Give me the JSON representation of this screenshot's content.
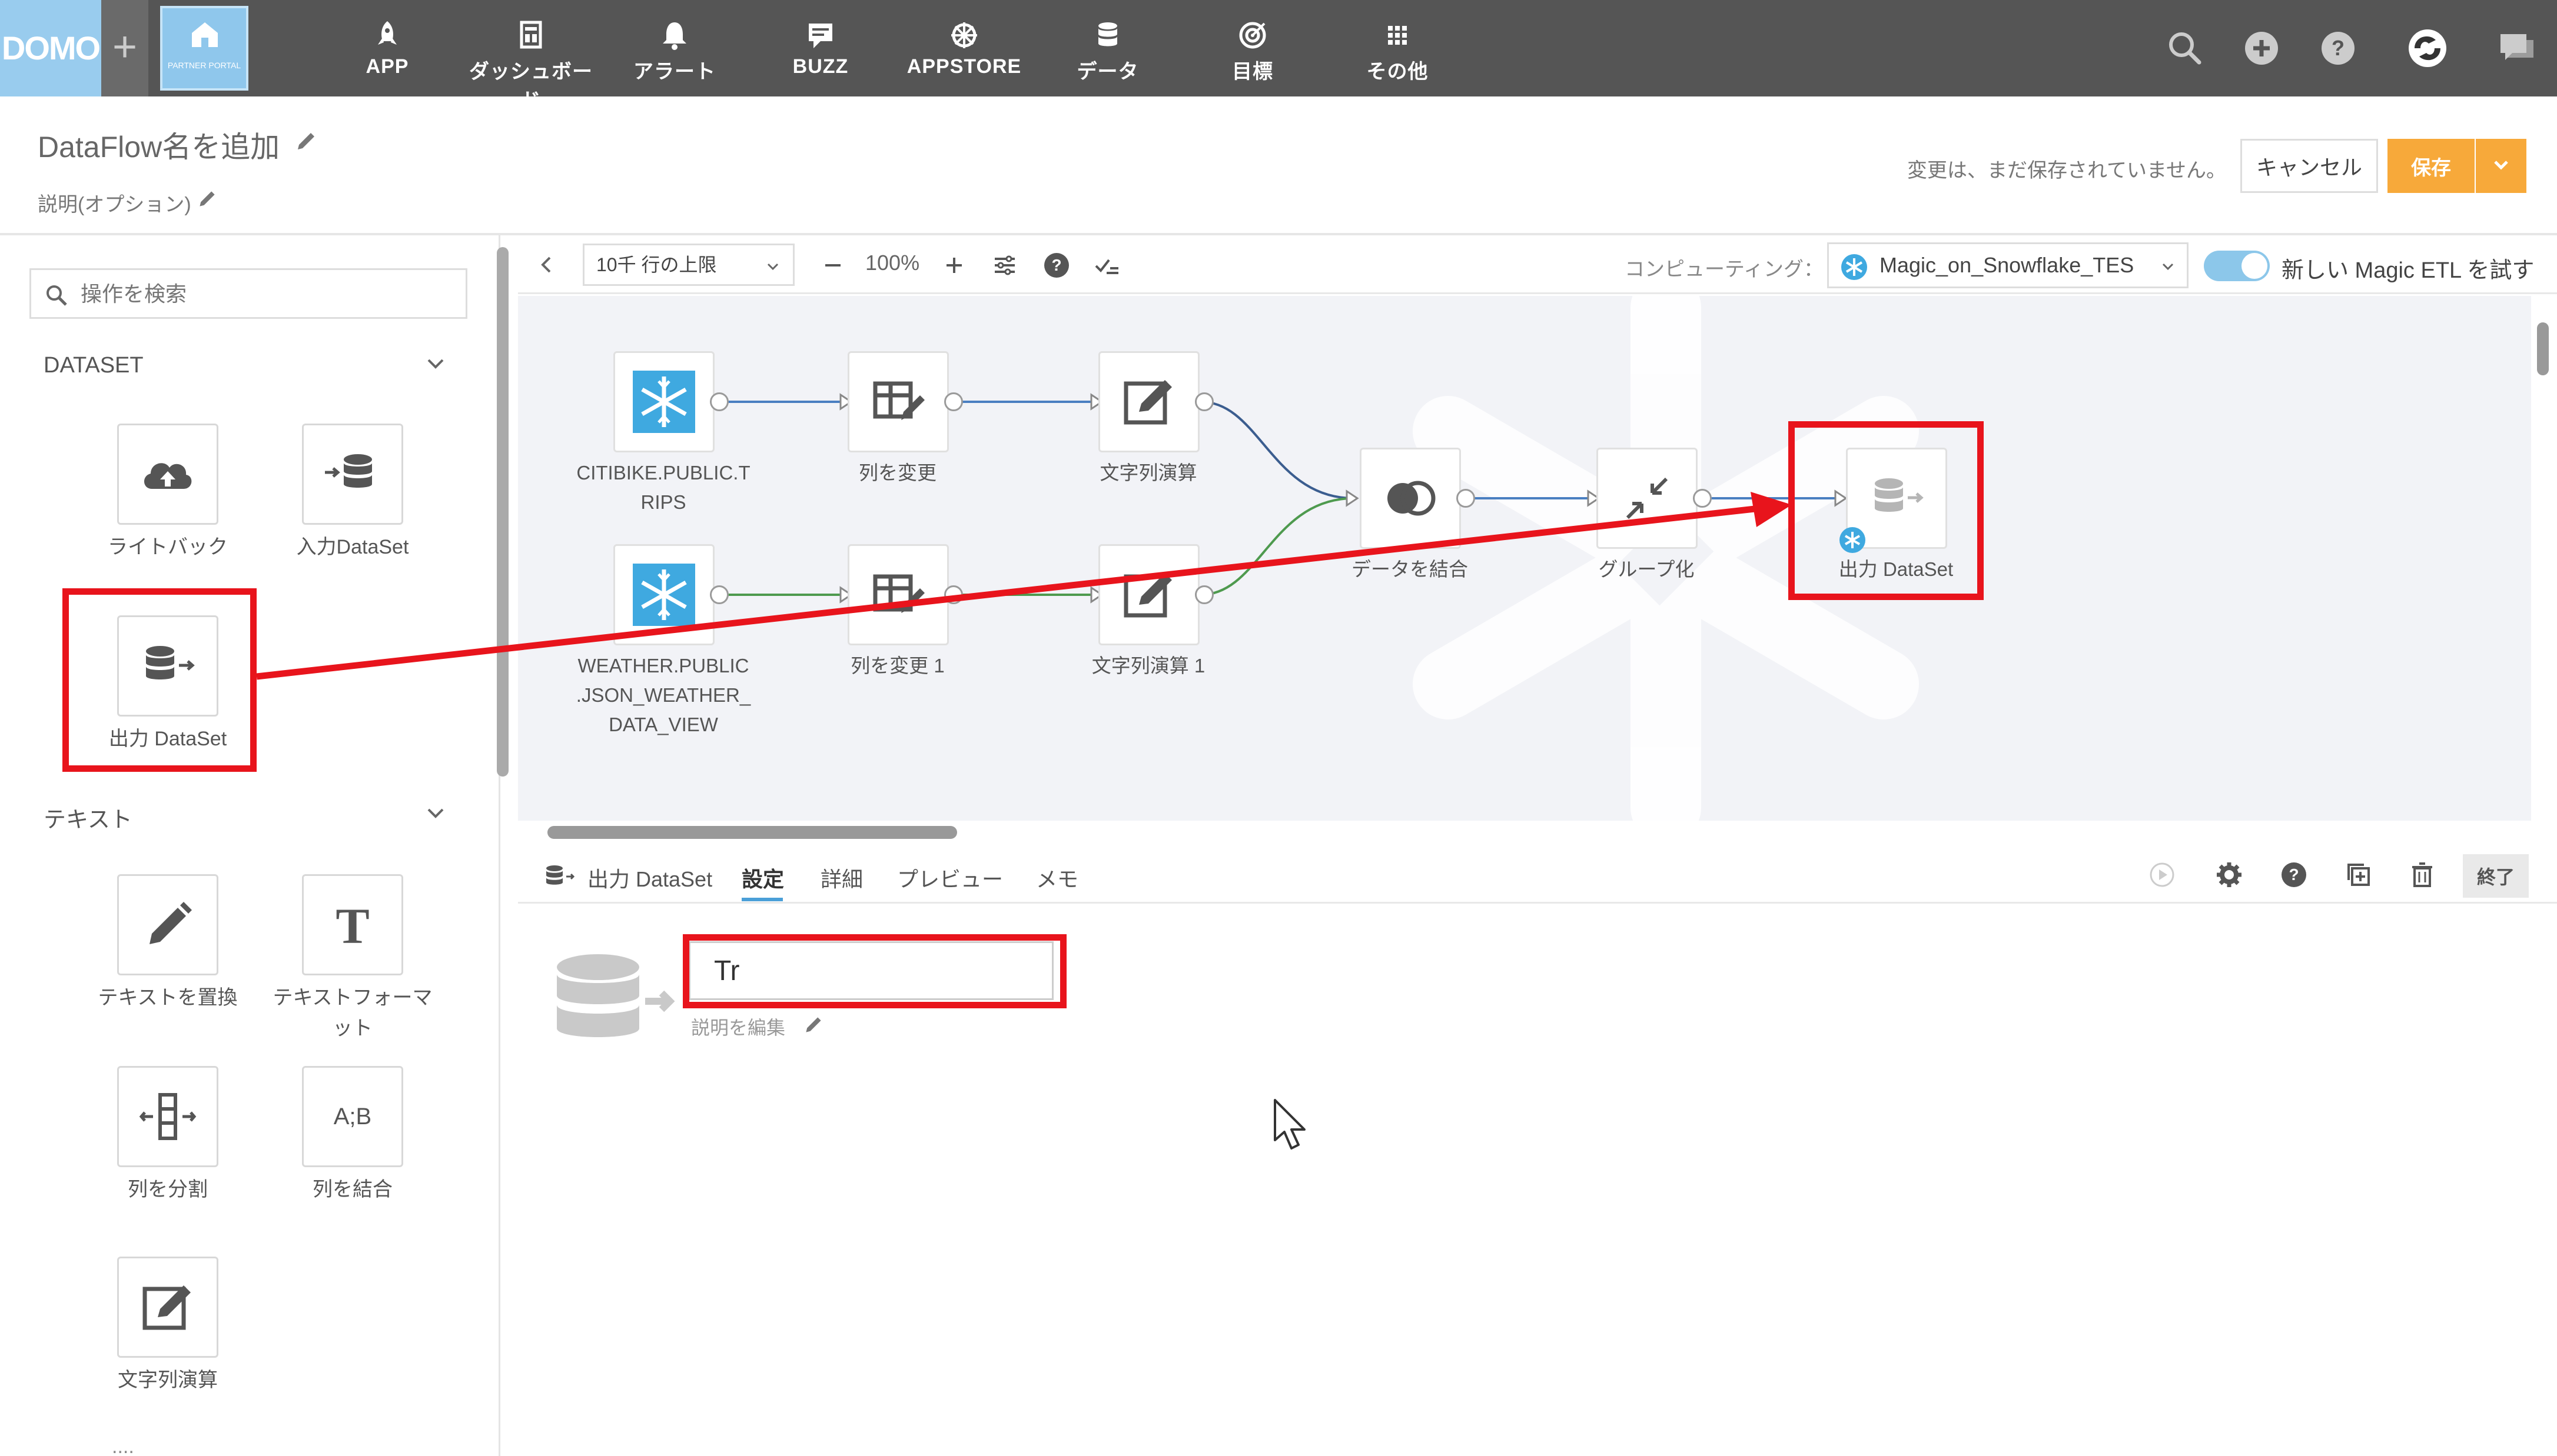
{
  "colors": {
    "nav_bg": "#555555",
    "accent_blue": "#4a9fd8",
    "save_orange": "#f7a93a",
    "annotation_red": "#e8141c"
  },
  "nav": {
    "logo": "DOMO",
    "plus": "+",
    "portal_text": "PARTNER PORTAL",
    "items": [
      {
        "label": "APP",
        "icon": "rocket-icon"
      },
      {
        "label": "ダッシュボード",
        "icon": "dashboard-icon"
      },
      {
        "label": "アラート",
        "icon": "bell-icon"
      },
      {
        "label": "BUZZ",
        "icon": "chat-icon"
      },
      {
        "label": "APPSTORE",
        "icon": "appstore-icon"
      },
      {
        "label": "データ",
        "icon": "database-icon"
      },
      {
        "label": "目標",
        "icon": "goal-icon"
      },
      {
        "label": "その他",
        "icon": "grid-icon"
      }
    ],
    "right_icons": [
      "search-icon",
      "add-circle-icon",
      "help-icon",
      "user-avatar-icon",
      "messages-icon"
    ]
  },
  "header": {
    "title": "DataFlow名を追加",
    "description": "説明(オプション)",
    "unsaved_message": "変更は、まだ保存されていません。",
    "cancel_label": "キャンセル",
    "save_label": "保存"
  },
  "left_panel": {
    "search_placeholder": "操作を検索",
    "sections": [
      {
        "title": "DATASET",
        "tiles": [
          {
            "label": "ライトバック",
            "icon": "cloud-upload-icon"
          },
          {
            "label": "入力DataSet",
            "icon": "input-dataset-icon"
          },
          {
            "label": "出力 DataSet",
            "icon": "output-dataset-icon"
          }
        ]
      },
      {
        "title": "テキスト",
        "tiles": [
          {
            "label": "テキストを置換",
            "icon": "pencil-icon"
          },
          {
            "label": "テキストフォーマット",
            "icon": "text-format-icon"
          },
          {
            "label": "列を分割",
            "icon": "split-column-icon"
          },
          {
            "label": "列を結合",
            "icon": "combine-column-icon"
          },
          {
            "label": "文字列演算",
            "icon": "string-calc-icon"
          }
        ]
      }
    ],
    "more": "...."
  },
  "toolbar": {
    "row_limit": "10千 行の上限",
    "zoom": "100%",
    "compute_label": "コンピューティング：",
    "compute_value": "Magic_on_Snowflake_TES",
    "toggle_on": true,
    "toggle_label": "新しい Magic ETL を試す"
  },
  "canvas": {
    "nodes": [
      {
        "id": "citibike",
        "label": "CITIBIKE.PUBLIC.TRIPS",
        "icon": "snowflake-icon"
      },
      {
        "id": "alter1",
        "label": "列を変更",
        "icon": "alter-columns-icon"
      },
      {
        "id": "strcalc1",
        "label": "文字列演算",
        "icon": "string-calc-icon"
      },
      {
        "id": "weather",
        "label": "WEATHER.PUBLIC.JSON_WEATHER_DATA_VIEW",
        "icon": "snowflake-icon"
      },
      {
        "id": "alter2",
        "label": "列を変更 1",
        "icon": "alter-columns-icon"
      },
      {
        "id": "strcalc2",
        "label": "文字列演算 1",
        "icon": "string-calc-icon"
      },
      {
        "id": "join",
        "label": "データを結合",
        "icon": "join-icon"
      },
      {
        "id": "group",
        "label": "グループ化",
        "icon": "group-by-icon"
      },
      {
        "id": "output",
        "label": "出力 DataSet",
        "icon": "output-dataset-icon"
      }
    ],
    "label_lines": {
      "citibike": [
        "CITIBIKE.PUBLIC.T",
        "RIPS"
      ],
      "weather": [
        "WEATHER.PUBLIC",
        ".JSON_WEATHER_",
        "DATA_VIEW"
      ]
    }
  },
  "bottom_panel": {
    "node_name": "出力 DataSet",
    "tabs": [
      "設定",
      "詳細",
      "プレビュー",
      "メモ"
    ],
    "active_tab": "設定",
    "close_label": "終了",
    "name_value": "Tr",
    "description_edit": "説明を編集",
    "icons": [
      "run-icon",
      "gear-icon",
      "help-icon",
      "copy-icon",
      "trash-icon"
    ]
  }
}
